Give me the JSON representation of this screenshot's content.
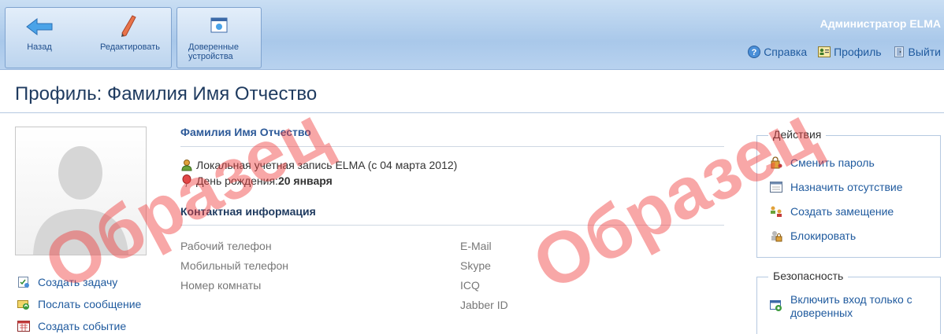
{
  "toolbar": {
    "back_label": "Назад",
    "edit_label": "Редактировать",
    "trusted_devices_label": "Доверенные устройства"
  },
  "header": {
    "user_name": "Администратор ELMA",
    "help_label": "Справка",
    "profile_label": "Профиль",
    "logout_label": "Выйти"
  },
  "page": {
    "title": "Профиль: Фамилия Имя Отчество"
  },
  "profile": {
    "full_name": "Фамилия Имя Отчество",
    "account_text": "Локальная учетная запись ELMA (с 04 марта 2012)",
    "birthday_label": "День рождения: ",
    "birthday_value": "20 января",
    "contact_section_title": "Контактная информация",
    "contact_labels_left": [
      "Рабочий телефон",
      "Мобильный телефон",
      "Номер комнаты"
    ],
    "contact_labels_right": [
      "E-Mail",
      "Skype",
      "ICQ",
      "Jabber ID"
    ]
  },
  "left_actions": {
    "create_task": "Создать задачу",
    "send_message": "Послать сообщение",
    "create_event": "Создать событие"
  },
  "actions_panel": {
    "title": "Действия",
    "change_password": "Сменить пароль",
    "set_absence": "Назначить отсутствие",
    "create_substitution": "Создать замещение",
    "block": "Блокировать"
  },
  "security_panel": {
    "title": "Безопасность",
    "trusted_login": "Включить вход только с доверенных"
  },
  "watermark": {
    "text": "Образец"
  },
  "colors": {
    "accent": "#1f5a9e",
    "toolbar_bg": "#b8d2ef",
    "watermark": "#f03c3c"
  }
}
